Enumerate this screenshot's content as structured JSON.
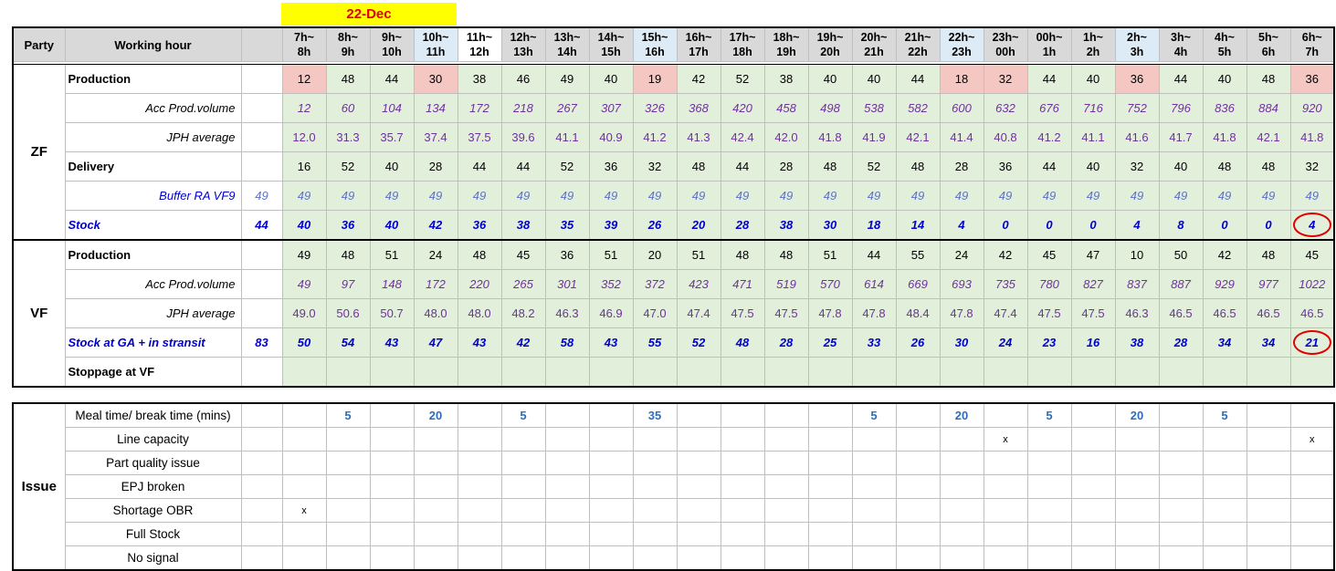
{
  "date": "22-Dec",
  "header": {
    "party": "Party",
    "working_hour": "Working hour",
    "hours": [
      [
        "7h~",
        "8h"
      ],
      [
        "8h~",
        "9h"
      ],
      [
        "9h~",
        "10h"
      ],
      [
        "10h~",
        "11h"
      ],
      [
        "11h~",
        "12h"
      ],
      [
        "12h~",
        "13h"
      ],
      [
        "13h~",
        "14h"
      ],
      [
        "14h~",
        "15h"
      ],
      [
        "15h~",
        "16h"
      ],
      [
        "16h~",
        "17h"
      ],
      [
        "17h~",
        "18h"
      ],
      [
        "18h~",
        "19h"
      ],
      [
        "19h~",
        "20h"
      ],
      [
        "20h~",
        "21h"
      ],
      [
        "21h~",
        "22h"
      ],
      [
        "22h~",
        "23h"
      ],
      [
        "23h~",
        "00h"
      ],
      [
        "00h~",
        "1h"
      ],
      [
        "1h~",
        "2h"
      ],
      [
        "2h~",
        "3h"
      ],
      [
        "3h~",
        "4h"
      ],
      [
        "4h~",
        "5h"
      ],
      [
        "5h~",
        "6h"
      ],
      [
        "6h~",
        "7h"
      ]
    ],
    "hour_shading": [
      "g",
      "g",
      "g",
      "b",
      "w",
      "g",
      "g",
      "g",
      "b",
      "g",
      "g",
      "g",
      "g",
      "g",
      "g",
      "b",
      "g",
      "g",
      "g",
      "b",
      "g",
      "g",
      "g",
      "g"
    ]
  },
  "zf": {
    "party": "ZF",
    "production": {
      "label": "Production",
      "values": [
        12,
        48,
        44,
        30,
        38,
        46,
        49,
        40,
        19,
        42,
        52,
        38,
        40,
        40,
        44,
        18,
        32,
        44,
        40,
        36,
        44,
        40,
        48,
        36
      ],
      "highlight": [
        true,
        false,
        false,
        true,
        false,
        false,
        false,
        false,
        true,
        false,
        false,
        false,
        false,
        false,
        false,
        true,
        true,
        false,
        false,
        true,
        false,
        false,
        false,
        true
      ]
    },
    "acc_prod": {
      "label": "Acc Prod.volume",
      "values": [
        12,
        60,
        104,
        134,
        172,
        218,
        267,
        307,
        326,
        368,
        420,
        458,
        498,
        538,
        582,
        600,
        632,
        676,
        716,
        752,
        796,
        836,
        884,
        920
      ]
    },
    "jph": {
      "label": "JPH average",
      "values": [
        "12.0",
        "31.3",
        "35.7",
        "37.4",
        "37.5",
        "39.6",
        "41.1",
        "40.9",
        "41.2",
        "41.3",
        "42.4",
        "42.0",
        "41.8",
        "41.9",
        "42.1",
        "41.4",
        "40.8",
        "41.2",
        "41.1",
        "41.6",
        "41.7",
        "41.8",
        "42.1",
        "41.8"
      ]
    },
    "delivery": {
      "label": "Delivery",
      "values": [
        16,
        52,
        40,
        28,
        44,
        44,
        52,
        36,
        32,
        48,
        44,
        28,
        48,
        52,
        48,
        28,
        36,
        44,
        40,
        32,
        40,
        48,
        48,
        32
      ]
    },
    "buffer": {
      "label": "Buffer RA VF9",
      "initial": 49,
      "values": [
        49,
        49,
        49,
        49,
        49,
        49,
        49,
        49,
        49,
        49,
        49,
        49,
        49,
        49,
        49,
        49,
        49,
        49,
        49,
        49,
        49,
        49,
        49,
        49
      ]
    },
    "stock": {
      "label": "Stock",
      "initial": 44,
      "values": [
        40,
        36,
        40,
        42,
        36,
        38,
        35,
        39,
        26,
        20,
        28,
        38,
        30,
        18,
        14,
        4,
        0,
        0,
        0,
        4,
        8,
        0,
        0,
        4
      ]
    }
  },
  "vf": {
    "party": "VF",
    "production": {
      "label": "Production",
      "values": [
        49,
        48,
        51,
        24,
        48,
        45,
        36,
        51,
        20,
        51,
        48,
        48,
        51,
        44,
        55,
        24,
        42,
        45,
        47,
        10,
        50,
        42,
        48,
        45
      ]
    },
    "acc_prod": {
      "label": "Acc Prod.volume",
      "values": [
        49,
        97,
        148,
        172,
        220,
        265,
        301,
        352,
        372,
        423,
        471,
        519,
        570,
        614,
        669,
        693,
        735,
        780,
        827,
        837,
        887,
        929,
        977,
        1022
      ]
    },
    "jph": {
      "label": "JPH average",
      "values": [
        "49.0",
        "50.6",
        "50.7",
        "48.0",
        "48.0",
        "48.2",
        "46.3",
        "46.9",
        "47.0",
        "47.4",
        "47.5",
        "47.5",
        "47.8",
        "47.8",
        "48.4",
        "47.8",
        "47.4",
        "47.5",
        "47.5",
        "46.3",
        "46.5",
        "46.5",
        "46.5",
        "46.5"
      ]
    },
    "stock": {
      "label": "Stock at GA + in stransit",
      "initial": 83,
      "values": [
        50,
        54,
        43,
        47,
        43,
        42,
        58,
        43,
        55,
        52,
        48,
        28,
        25,
        33,
        26,
        30,
        24,
        23,
        16,
        38,
        28,
        34,
        34,
        21
      ]
    },
    "stoppage": {
      "label": "Stoppage at VF"
    }
  },
  "issue": {
    "party": "Issue",
    "rows": [
      {
        "label": "Meal time/ break time (mins)",
        "values": [
          "",
          "5",
          "",
          "20",
          "",
          "5",
          "",
          "",
          "35",
          "",
          "",
          "",
          "",
          "5",
          "",
          "20",
          "",
          "5",
          "",
          "20",
          "",
          "5",
          "",
          ""
        ]
      },
      {
        "label": "Line capacity",
        "values": [
          "",
          "",
          "",
          "",
          "",
          "",
          "",
          "",
          "",
          "",
          "",
          "",
          "",
          "",
          "",
          "",
          "x",
          "",
          "",
          "",
          "",
          "",
          "",
          "x"
        ]
      },
      {
        "label": "Part quality issue",
        "values": [
          "",
          "",
          "",
          "",
          "",
          "",
          "",
          "",
          "",
          "",
          "",
          "",
          "",
          "",
          "",
          "",
          "",
          "",
          "",
          "",
          "",
          "",
          "",
          ""
        ]
      },
      {
        "label": "EPJ broken",
        "values": [
          "",
          "",
          "",
          "",
          "",
          "",
          "",
          "",
          "",
          "",
          "",
          "",
          "",
          "",
          "",
          "",
          "",
          "",
          "",
          "",
          "",
          "",
          "",
          ""
        ]
      },
      {
        "label": "Shortage OBR",
        "values": [
          "x",
          "",
          "",
          "",
          "",
          "",
          "",
          "",
          "",
          "",
          "",
          "",
          "",
          "",
          "",
          "",
          "",
          "",
          "",
          "",
          "",
          "",
          "",
          ""
        ]
      },
      {
        "label": "Full Stock",
        "values": [
          "",
          "",
          "",
          "",
          "",
          "",
          "",
          "",
          "",
          "",
          "",
          "",
          "",
          "",
          "",
          "",
          "",
          "",
          "",
          "",
          "",
          "",
          "",
          ""
        ]
      },
      {
        "label": "No signal",
        "values": [
          "",
          "",
          "",
          "",
          "",
          "",
          "",
          "",
          "",
          "",
          "",
          "",
          "",
          "",
          "",
          "",
          "",
          "",
          "",
          "",
          "",
          "",
          "",
          ""
        ]
      }
    ]
  },
  "colors": {
    "banner_bg": "#ffff00",
    "banner_text": "#e00000",
    "cell_green": "#e2efda",
    "cell_red": "#f4c7c3",
    "stock_blue": "#0000cc",
    "circle_red": "#e00000"
  }
}
